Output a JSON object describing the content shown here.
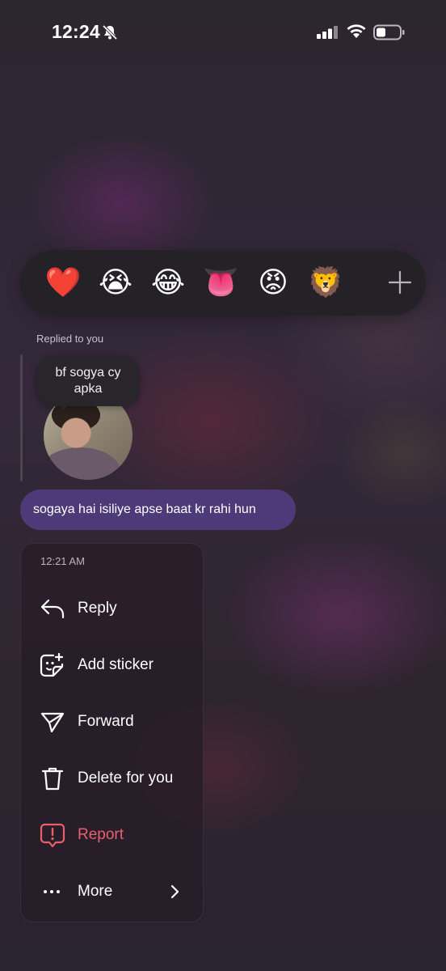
{
  "status_bar": {
    "time": "12:24",
    "icons": [
      "bell-slash-icon",
      "signal-icon",
      "wifi-icon",
      "battery-icon"
    ]
  },
  "reactions": {
    "emojis": [
      "❤️",
      "😭",
      "😂",
      "👅",
      "😡",
      "🦁"
    ],
    "more_icon": "plus-icon"
  },
  "replied_label": "Replied to you",
  "story_reply": {
    "quote_text": "bf sogya cy apka"
  },
  "message": {
    "text": "sogaya hai isiliye apse baat kr rahi hun",
    "bubble_color": "#4e3a78"
  },
  "menu": {
    "timestamp": "12:21 AM",
    "items": [
      {
        "label": "Reply",
        "icon": "reply-icon"
      },
      {
        "label": "Add sticker",
        "icon": "sticker-icon"
      },
      {
        "label": "Forward",
        "icon": "forward-icon"
      },
      {
        "label": "Delete for you",
        "icon": "trash-icon"
      },
      {
        "label": "Report",
        "icon": "report-icon",
        "color": "#e8606b"
      },
      {
        "label": "More",
        "icon": "more-icon"
      }
    ]
  }
}
